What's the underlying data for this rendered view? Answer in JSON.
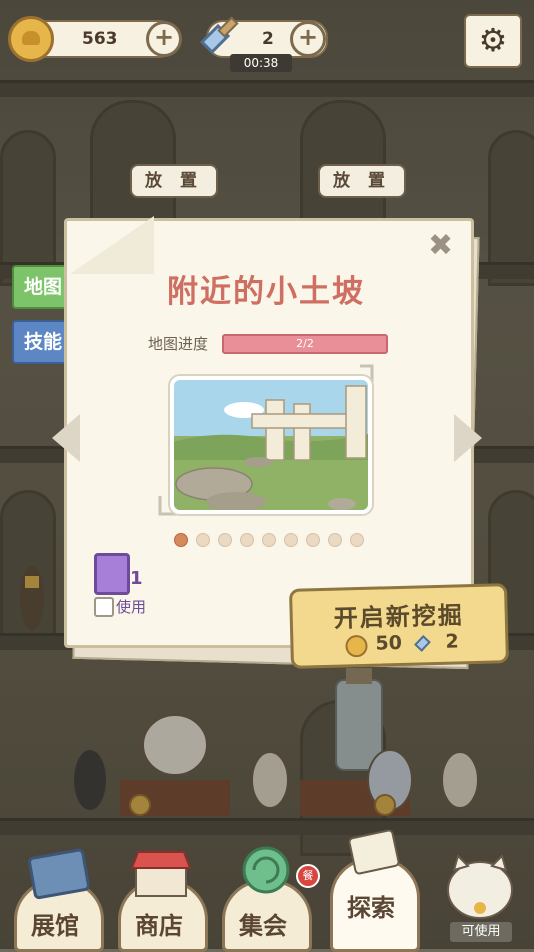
{
  "top_bar": {
    "coins": "563",
    "shovels": "2",
    "timer": "00:38"
  },
  "shelf": {
    "place_label": "放 置"
  },
  "side_tabs": {
    "map": "地图",
    "skills": "技能"
  },
  "modal": {
    "title": "附近的小土坡",
    "progress_label": "地图进度",
    "progress_text": "2/2",
    "progress": 1.0,
    "page_dots": {
      "total": 9,
      "active": 1
    },
    "item_count": "1",
    "use_checkbox_label": "使用",
    "start_button_label": "开启新挖掘",
    "cost_coins": "50",
    "cost_shovels": "2"
  },
  "nav": {
    "items": [
      {
        "label": "展馆"
      },
      {
        "label": "商店"
      },
      {
        "label": "集会"
      },
      {
        "label": "探索"
      }
    ],
    "badge": "餐",
    "available_label": "可使用"
  },
  "colors": {
    "title": "#cf6f62",
    "progress_fill": "#e98f98",
    "map_tab": "#7cc36a",
    "skill_tab": "#5d86c4",
    "button": "#f3d98d"
  }
}
